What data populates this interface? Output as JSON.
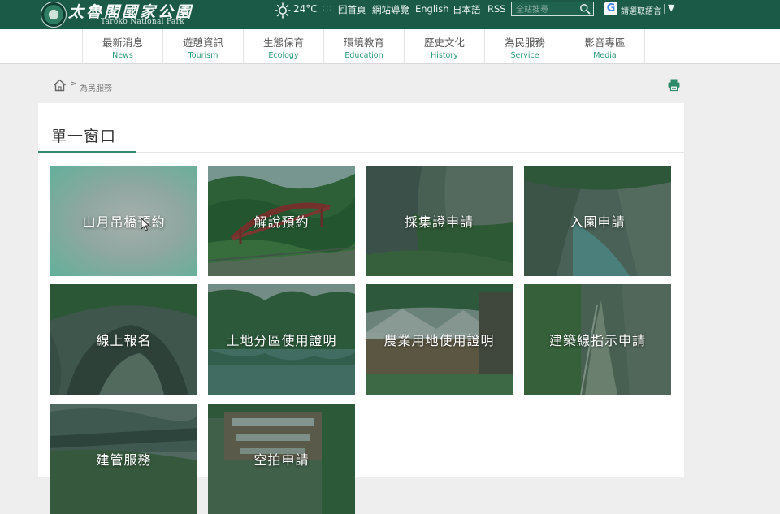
{
  "header": {
    "logo_text": "太魯閣國家公園",
    "logo_subtitle": "Taroko National Park",
    "temperature": "24°C",
    "separator": ":::",
    "links": [
      {
        "label": "回首頁",
        "name": "home-link"
      },
      {
        "label": "網站導覽",
        "name": "sitemap-link"
      },
      {
        "label": "English",
        "name": "english-link"
      },
      {
        "label": "日本語",
        "name": "japanese-link"
      },
      {
        "label": "RSS",
        "name": "rss-link"
      }
    ],
    "search_placeholder": "全站搜尋",
    "google_letter": "G",
    "translate_label": "請選取語言",
    "caret": "▼"
  },
  "nav": {
    "items": [
      {
        "zh": "最新消息",
        "en": "News"
      },
      {
        "zh": "遊憩資訊",
        "en": "Tourism"
      },
      {
        "zh": "生態保育",
        "en": "Ecology"
      },
      {
        "zh": "環境教育",
        "en": "Education"
      },
      {
        "zh": "歷史文化",
        "en": "History"
      },
      {
        "zh": "為民服務",
        "en": "Service"
      },
      {
        "zh": "影音專區",
        "en": "Media"
      }
    ]
  },
  "breadcrumb": {
    "separator": ">",
    "current": "為民服務"
  },
  "main": {
    "title": "單一窗口",
    "tiles": [
      {
        "label": "山月吊橋預約"
      },
      {
        "label": "解說預約"
      },
      {
        "label": "採集證申請"
      },
      {
        "label": "入園申請"
      },
      {
        "label": "線上報名"
      },
      {
        "label": "土地分區使用證明"
      },
      {
        "label": "農業用地使用證明"
      },
      {
        "label": "建築線指示申請"
      },
      {
        "label": "建管服務"
      },
      {
        "label": "空拍申請"
      }
    ]
  },
  "colors": {
    "header_bg": "#1b5a47",
    "accent": "#2f8a67",
    "nav_en": "#2e9a72"
  }
}
